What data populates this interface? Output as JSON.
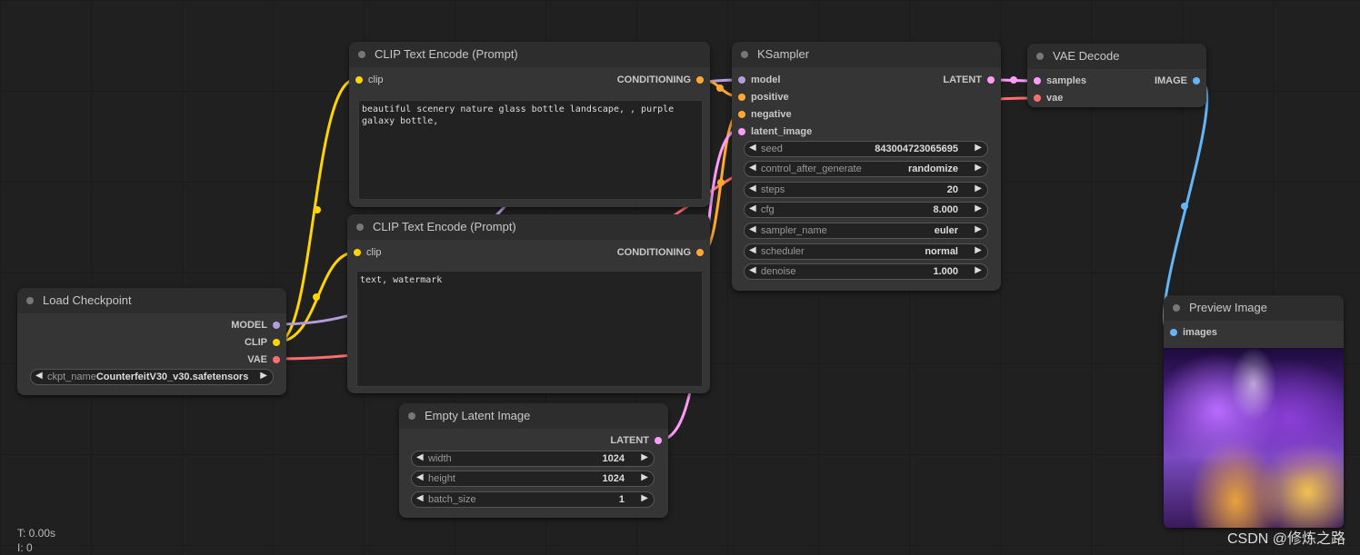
{
  "nodes": {
    "clip_pos": {
      "title": "CLIP Text Encode (Prompt)",
      "input_clip": "clip",
      "output": "CONDITIONING",
      "text": "beautiful scenery nature glass bottle landscape, , purple galaxy bottle,"
    },
    "clip_neg": {
      "title": "CLIP Text Encode (Prompt)",
      "input_clip": "clip",
      "output": "CONDITIONING",
      "text": "text, watermark"
    },
    "ksampler": {
      "title": "KSampler",
      "inputs": [
        "model",
        "positive",
        "negative",
        "latent_image"
      ],
      "output": "LATENT",
      "widgets": [
        {
          "label": "seed",
          "value": "843004723065695"
        },
        {
          "label": "control_after_generate",
          "value": "randomize"
        },
        {
          "label": "steps",
          "value": "20"
        },
        {
          "label": "cfg",
          "value": "8.000"
        },
        {
          "label": "sampler_name",
          "value": "euler"
        },
        {
          "label": "scheduler",
          "value": "normal"
        },
        {
          "label": "denoise",
          "value": "1.000"
        }
      ]
    },
    "vae_decode": {
      "title": "VAE Decode",
      "inputs": [
        "samples",
        "vae"
      ],
      "output": "IMAGE"
    },
    "load_checkpoint": {
      "title": "Load Checkpoint",
      "outputs": [
        "MODEL",
        "CLIP",
        "VAE"
      ],
      "widget_label": "ckpt_name",
      "widget_value": "CounterfeitV30_v30.safetensors"
    },
    "empty_latent": {
      "title": "Empty Latent Image",
      "output": "LATENT",
      "widgets": [
        {
          "label": "width",
          "value": "1024"
        },
        {
          "label": "height",
          "value": "1024"
        },
        {
          "label": "batch_size",
          "value": "1"
        }
      ]
    },
    "preview": {
      "title": "Preview Image",
      "input": "images"
    }
  },
  "colors": {
    "clip": "#ffd500",
    "conditioning": "#ffa931",
    "model": "#b39ddb",
    "latent": "#ff9cf9",
    "vae": "#ff6e6e",
    "image": "#64b5f6"
  },
  "footer": {
    "time": "T: 0.00s",
    "index": "I: 0",
    "watermark": "CSDN @修炼之路"
  }
}
